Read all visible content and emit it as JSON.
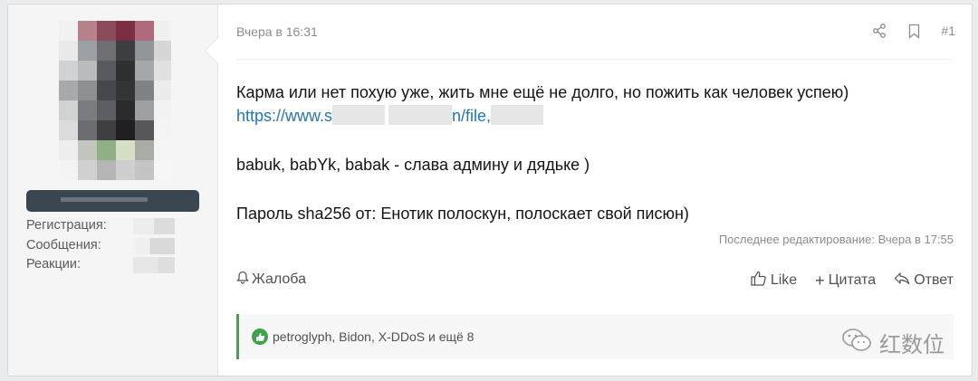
{
  "post": {
    "timestamp": "Вчера в 16:31",
    "post_number": "#1",
    "lines": {
      "line1": "Карма или нет похую уже, жить мне ещё не долго, но пожить как человек успею)",
      "link_prefix": "https://www.s",
      "link_mid": "n/file,",
      "line2": "babuk, babYk, babak - слава админу и дядьке )",
      "line3": "Пароль sha256 от: Енотик полоскун, полоскает свой писюн)"
    },
    "edited": "Последнее редактирование: Вчера в 17:55"
  },
  "user": {
    "stats": {
      "registration": "Регистрация:",
      "messages": "Сообщения:",
      "reactions": "Реакции:"
    }
  },
  "footer": {
    "report": "Жалоба",
    "like": "Like",
    "quote": "Цитата",
    "reply": "Ответ"
  },
  "reactions_bar": {
    "text": "petroglyph, Bidon, X-DDoS и ещё 8"
  },
  "watermark": "红数位",
  "colors": {
    "accent_link": "#2577b1",
    "like_green": "#3fa24a"
  }
}
